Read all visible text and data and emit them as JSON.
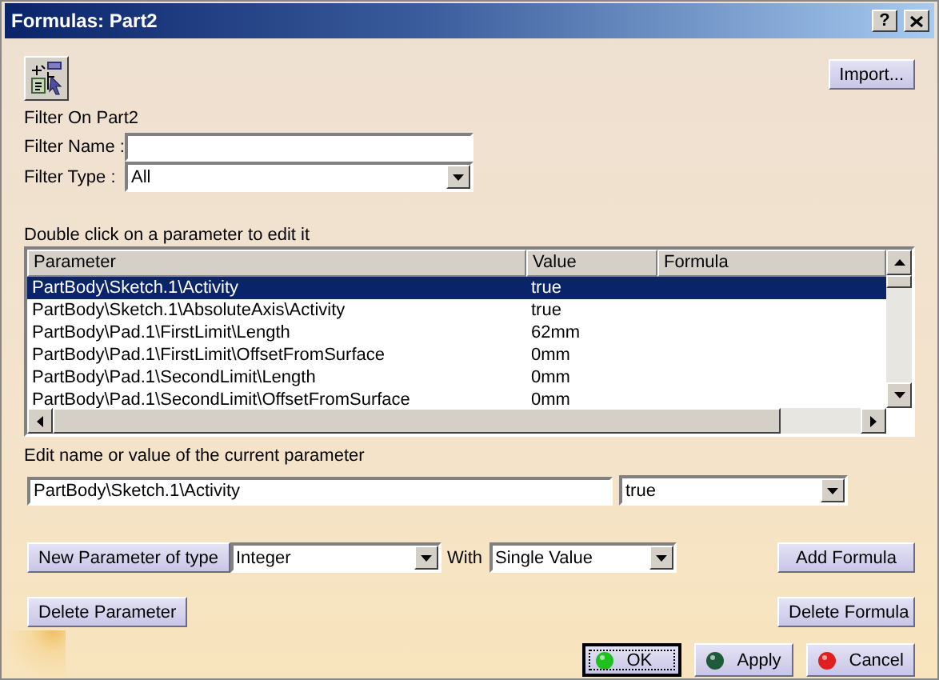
{
  "window": {
    "title": "Formulas: Part2",
    "help_button": "?"
  },
  "toolbar": {
    "import_button": "Import..."
  },
  "filter": {
    "heading": "Filter On Part2",
    "name_label": "Filter Name :",
    "type_label": "Filter Type :",
    "type_value": "All"
  },
  "table": {
    "caption": "Double click on a parameter to edit it",
    "columns": [
      "Parameter",
      "Value",
      "Formula"
    ],
    "rows": [
      {
        "parameter": "PartBody\\Sketch.1\\Activity",
        "value": "true",
        "selected": true
      },
      {
        "parameter": "PartBody\\Sketch.1\\AbsoluteAxis\\Activity",
        "value": "true",
        "selected": false
      },
      {
        "parameter": "PartBody\\Pad.1\\FirstLimit\\Length",
        "value": "62mm",
        "selected": false
      },
      {
        "parameter": "PartBody\\Pad.1\\FirstLimit\\OffsetFromSurface",
        "value": "0mm",
        "selected": false
      },
      {
        "parameter": "PartBody\\Pad.1\\SecondLimit\\Length",
        "value": "0mm",
        "selected": false
      },
      {
        "parameter": "PartBody\\Pad.1\\SecondLimit\\OffsetFromSurface",
        "value": "0mm",
        "selected": false
      }
    ]
  },
  "editor": {
    "caption": "Edit name or value of the current parameter",
    "name_value": "PartBody\\Sketch.1\\Activity",
    "value": "true"
  },
  "new_parameter": {
    "button": "New Parameter of type",
    "type_value": "Integer",
    "with_label": "With",
    "with_value": "Single Value",
    "add_formula_button": "Add Formula"
  },
  "delete_row": {
    "delete_parameter_button": "Delete Parameter",
    "delete_formula_button": "Delete Formula"
  },
  "dialog_buttons": [
    {
      "label": "OK",
      "color": "#20c020",
      "default": true
    },
    {
      "label": "Apply",
      "color": "#1f5a3a",
      "default": false
    },
    {
      "label": "Cancel",
      "color": "#e02020",
      "default": false
    }
  ]
}
